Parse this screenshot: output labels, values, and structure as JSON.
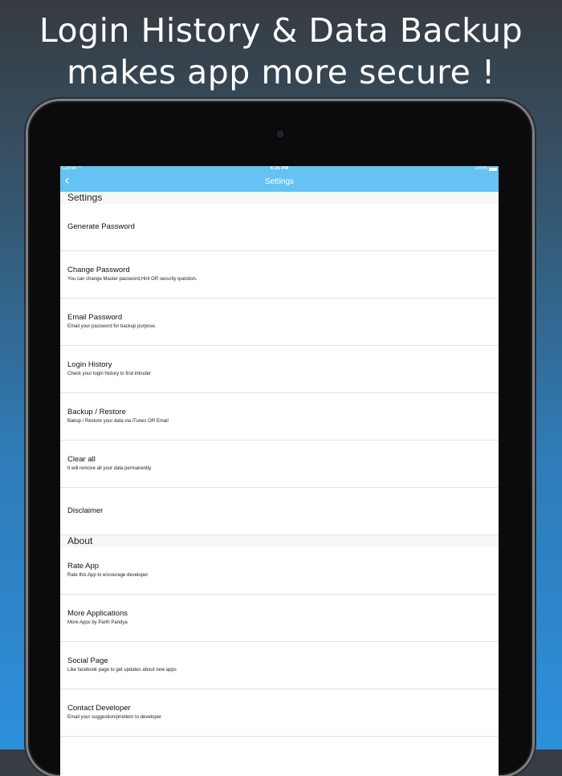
{
  "headline": {
    "line1": "Login History & Data Backup",
    "line2": "makes app more secure !"
  },
  "status_bar": {
    "carrier": "Carrier",
    "time": "6:35 PM",
    "battery": "100%"
  },
  "nav": {
    "title": "Settings",
    "back_icon": "chevron-left-icon"
  },
  "sections": {
    "settings": {
      "header": "Settings",
      "items": [
        {
          "label": "Generate Password",
          "sub": ""
        },
        {
          "label": "Change Password",
          "sub": "You can change Master password,Hint OR security question."
        },
        {
          "label": "Email Password",
          "sub": "Email your password for backup purpose."
        },
        {
          "label": "Login History",
          "sub": "Check your login history to find intruder"
        },
        {
          "label": "Backup / Restore",
          "sub": "Bakup / Restore your data via iTunes OR Email"
        },
        {
          "label": "Clear all",
          "sub": "It will remove all your data permanently."
        },
        {
          "label": "Disclaimer",
          "sub": ""
        }
      ]
    },
    "about": {
      "header": "About",
      "items": [
        {
          "label": "Rate App",
          "sub": "Rate this App to encourage developer"
        },
        {
          "label": "More Applications",
          "sub": "More Apps by Parth Pandya"
        },
        {
          "label": "Social Page",
          "sub": "Like facebook page to get updates about new apps"
        },
        {
          "label": "Contact Developer",
          "sub": "Email your suggestion/problem to developer"
        }
      ]
    }
  },
  "colors": {
    "nav_bar": "#64c3f3",
    "background_top": "#373b40",
    "background_bottom": "#2d8fdb"
  }
}
